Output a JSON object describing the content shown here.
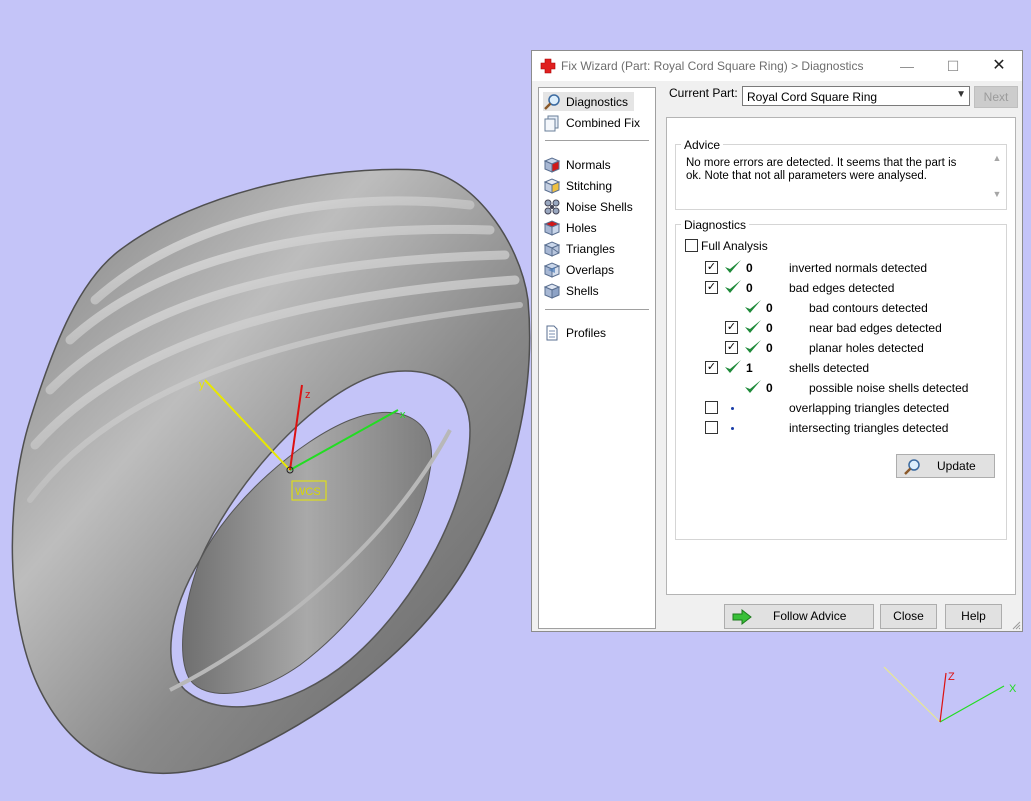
{
  "window": {
    "title": "Fix Wizard (Part: Royal Cord Square Ring) > Diagnostics",
    "minimize": "—",
    "maximize": "☐",
    "close": "✕"
  },
  "viewport": {
    "axis_labels": {
      "x": "x",
      "y": "y",
      "z": "z"
    },
    "wcs_label": "WCS",
    "mini_axis": {
      "x": "X",
      "z": "Z"
    }
  },
  "sidebar": {
    "items": [
      {
        "label": "Diagnostics",
        "icon": "magnifier-icon",
        "active": true
      },
      {
        "label": "Combined Fix",
        "icon": "pages-icon"
      },
      {
        "label": "Normals",
        "icon": "cube-red-face-icon"
      },
      {
        "label": "Stitching",
        "icon": "cube-stitch-icon"
      },
      {
        "label": "Noise Shells",
        "icon": "dots-icon"
      },
      {
        "label": "Holes",
        "icon": "cube-hole-icon"
      },
      {
        "label": "Triangles",
        "icon": "cube-triangle-icon"
      },
      {
        "label": "Overlaps",
        "icon": "cube-overlap-icon"
      },
      {
        "label": "Shells",
        "icon": "cube-shell-icon"
      },
      {
        "label": "Profiles",
        "icon": "document-icon"
      }
    ]
  },
  "header": {
    "current_part_label": "Current Part:",
    "current_part_value": "Royal Cord Square Ring",
    "next_label": "Next"
  },
  "advice": {
    "title": "Advice",
    "text": "No more errors are detected. It seems that the part is ok. Note that not all parameters were analysed."
  },
  "diagnostics": {
    "title": "Diagnostics",
    "full_analysis_label": "Full Analysis",
    "full_analysis_checked": false,
    "rows": [
      {
        "checkbox": true,
        "checked": true,
        "status": "check",
        "value": "0",
        "label": "inverted normals detected",
        "indent": 0
      },
      {
        "checkbox": true,
        "checked": true,
        "status": "check",
        "value": "0",
        "label": "bad edges detected",
        "indent": 0
      },
      {
        "checkbox": false,
        "checked": false,
        "status": "check",
        "value": "0",
        "label": "bad contours detected",
        "indent": 1
      },
      {
        "checkbox": true,
        "checked": true,
        "status": "check",
        "value": "0",
        "label": "near bad edges detected",
        "indent": 1
      },
      {
        "checkbox": true,
        "checked": true,
        "status": "check",
        "value": "0",
        "label": "planar holes detected",
        "indent": 1
      },
      {
        "checkbox": true,
        "checked": true,
        "status": "check",
        "value": "1",
        "label": "shells detected",
        "indent": 0
      },
      {
        "checkbox": false,
        "checked": false,
        "status": "check",
        "value": "0",
        "label": "possible noise shells detected",
        "indent": 1
      },
      {
        "checkbox": true,
        "checked": false,
        "status": "dot",
        "value": "",
        "label": "overlapping triangles detected",
        "indent": 0
      },
      {
        "checkbox": true,
        "checked": false,
        "status": "dot",
        "value": "",
        "label": "intersecting triangles detected",
        "indent": 0
      }
    ],
    "update_label": "Update"
  },
  "footer": {
    "follow_advice_label": "Follow Advice",
    "close_label": "Close",
    "help_label": "Help"
  },
  "colors": {
    "background": "#c4c4f8",
    "check_green": "#1f8a3a",
    "axis_x": "#22dd22",
    "axis_y": "#e8e800",
    "axis_z": "#dd1111"
  }
}
